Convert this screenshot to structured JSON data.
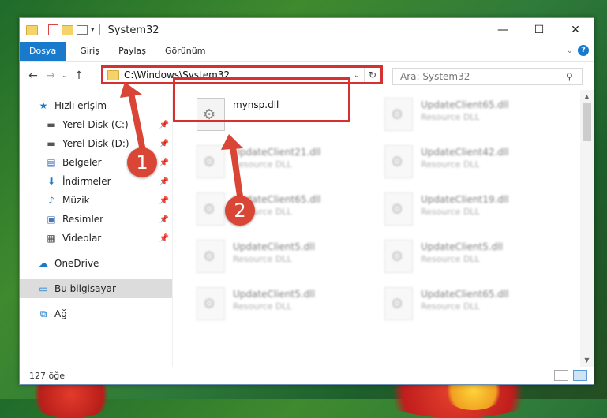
{
  "window": {
    "title": "System32"
  },
  "menu": {
    "tabs": [
      "Dosya",
      "Giriş",
      "Paylaş",
      "Görünüm"
    ]
  },
  "address": {
    "path": "C:\\Windows\\System32"
  },
  "search": {
    "placeholder": "Ara: System32"
  },
  "sidebar": {
    "items": [
      {
        "label": "Hızlı erişim",
        "icon": "star-icon",
        "pinned": false,
        "selected": false
      },
      {
        "label": "Yerel Disk (C:)",
        "icon": "drive-icon",
        "pinned": true,
        "selected": false
      },
      {
        "label": "Yerel Disk (D:)",
        "icon": "drive-icon",
        "pinned": true,
        "selected": false
      },
      {
        "label": "Belgeler",
        "icon": "documents-icon",
        "pinned": true,
        "selected": false
      },
      {
        "label": "İndirmeler",
        "icon": "download-icon",
        "pinned": true,
        "selected": false
      },
      {
        "label": "Müzik",
        "icon": "music-icon",
        "pinned": true,
        "selected": false
      },
      {
        "label": "Resimler",
        "icon": "pictures-icon",
        "pinned": true,
        "selected": false
      },
      {
        "label": "Videolar",
        "icon": "videos-icon",
        "pinned": true,
        "selected": false
      },
      {
        "label": "OneDrive",
        "icon": "cloud-icon",
        "pinned": false,
        "selected": false
      },
      {
        "label": "Bu bilgisayar",
        "icon": "computer-icon",
        "pinned": false,
        "selected": true
      },
      {
        "label": "Ağ",
        "icon": "network-icon",
        "pinned": false,
        "selected": false
      }
    ]
  },
  "files": [
    {
      "name": "mynsp.dll",
      "type": ""
    },
    {
      "name": "UpdateClient65.dll",
      "type": "Resource DLL"
    },
    {
      "name": "UpdateClient21.dll",
      "type": "Resource DLL"
    },
    {
      "name": "UpdateClient42.dll",
      "type": "Resource DLL"
    },
    {
      "name": "UpdateClient65.dll",
      "type": "Resource DLL"
    },
    {
      "name": "UpdateClient19.dll",
      "type": "Resource DLL"
    },
    {
      "name": "UpdateClient5.dll",
      "type": "Resource DLL"
    },
    {
      "name": "UpdateClient5.dll",
      "type": "Resource DLL"
    },
    {
      "name": "UpdateClient5.dll",
      "type": "Resource DLL"
    },
    {
      "name": "UpdateClient65.dll",
      "type": "Resource DLL"
    }
  ],
  "status": {
    "count": "127 öğe"
  },
  "annotations": {
    "step1": "1",
    "step2": "2"
  },
  "colors": {
    "accent": "#1979ca",
    "highlight": "#d63031",
    "badge": "#d94636"
  }
}
